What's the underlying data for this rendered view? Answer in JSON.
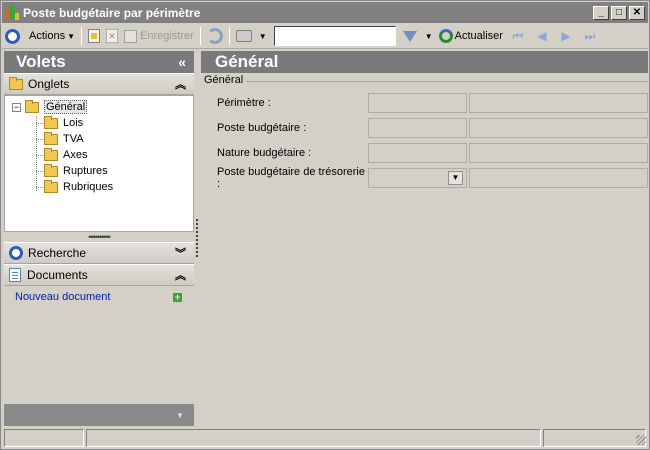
{
  "window": {
    "title": "Poste budgétaire par périmètre"
  },
  "toolbar": {
    "actions_label": "Actions",
    "save_label": "Enregistrer",
    "refresh_label": "Actualiser"
  },
  "left": {
    "header": "Volets",
    "collapse_glyph": "«",
    "sections": {
      "onglets": "Onglets",
      "recherche": "Recherche",
      "documents": "Documents"
    },
    "tree": {
      "root": "Général",
      "children": [
        "Lois",
        "TVA",
        "Axes",
        "Ruptures",
        "Rubriques"
      ]
    },
    "new_document_link": "Nouveau document"
  },
  "main": {
    "header": "Général",
    "group_title": "Général",
    "fields": [
      {
        "label": "Périmètre :",
        "value_a": "",
        "value_b": ""
      },
      {
        "label": "Poste budgétaire :",
        "value_a": "",
        "value_b": ""
      },
      {
        "label": "Nature budgétaire :",
        "value_a": "",
        "value_b": ""
      },
      {
        "label": "Poste budgétaire de trésorerie :",
        "value_a": "",
        "value_b": ""
      }
    ]
  },
  "colors": {
    "panel_header": "#7a7a7a",
    "link": "#0020b0",
    "accent_blue": "#2a5cb8"
  }
}
